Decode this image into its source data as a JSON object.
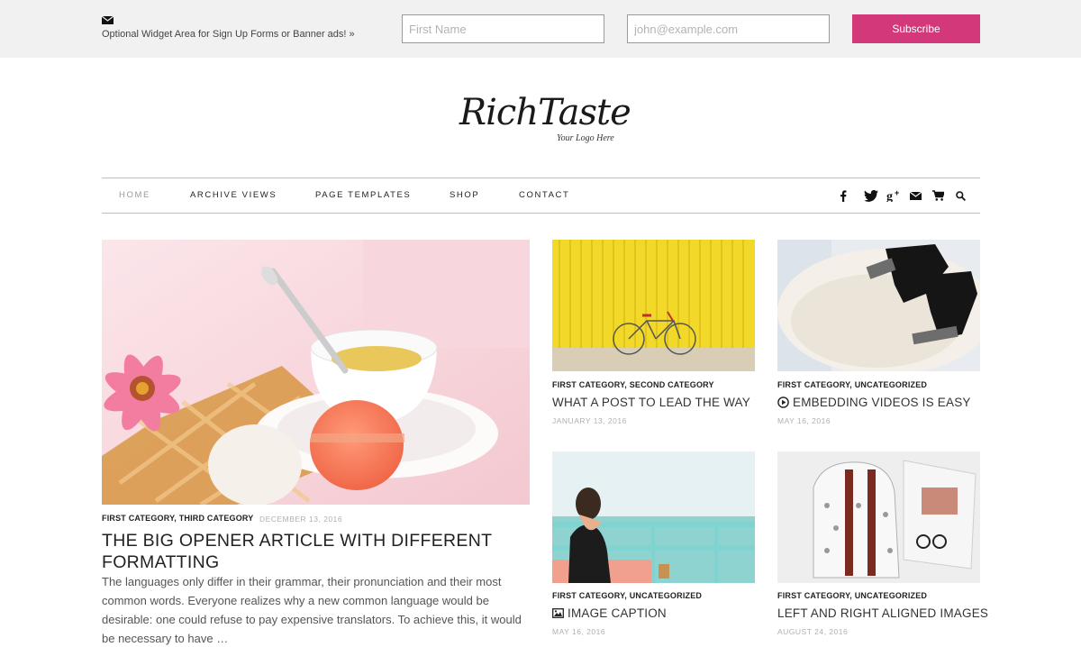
{
  "topbar": {
    "mail_icon": "envelope-icon",
    "widget_text": "Optional Widget Area for Sign Up Forms or Banner ads! »",
    "first_name_placeholder": "First Name",
    "email_placeholder": "john@example.com",
    "subscribe_label": "Subscribe"
  },
  "logo": {
    "brand": "RichTaste",
    "tagline": "Your Logo Here"
  },
  "nav": {
    "items": [
      {
        "label": "Home"
      },
      {
        "label": "Archive Views"
      },
      {
        "label": "Page Templates"
      },
      {
        "label": "Shop"
      },
      {
        "label": "Contact"
      }
    ],
    "icons": [
      "facebook-icon",
      "twitter-icon",
      "google-plus-icon",
      "mail-icon",
      "cart-icon",
      "search-icon"
    ]
  },
  "featured": {
    "categories": "FIRST CATEGORY, THIRD CATEGORY",
    "date": "DECEMBER 13, 2016",
    "title": "THE BIG OPENER ARTICLE WITH DIFFERENT FORMATTING",
    "excerpt": "The languages only differ in their grammar, their pronunciation and their most common words. Everyone realizes why a new common language would be desirable: one could refuse to pay expensive translators. To achieve this, it would be necessary to have …"
  },
  "posts": [
    {
      "categories": "FIRST CATEGORY, SECOND CATEGORY",
      "title": "WHAT A POST TO LEAD THE WAY",
      "date": "JANUARY 13, 2016",
      "icon": ""
    },
    {
      "categories": "FIRST CATEGORY, UNCATEGORIZED",
      "title": "EMBEDDING VIDEOS IS EASY",
      "date": "MAY 16, 2016",
      "icon": "play-circle-icon"
    },
    {
      "categories": "FIRST CATEGORY, UNCATEGORIZED",
      "title": "IMAGE CAPTION",
      "date": "MAY 16, 2016",
      "icon": "image-icon"
    },
    {
      "categories": "FIRST CATEGORY, UNCATEGORIZED",
      "title": "LEFT AND RIGHT ALIGNED IMAGES",
      "date": "AUGUST 24, 2016",
      "icon": ""
    }
  ],
  "colors": {
    "accent": "#d3387a",
    "topbar_bg": "#f1f1f1"
  }
}
